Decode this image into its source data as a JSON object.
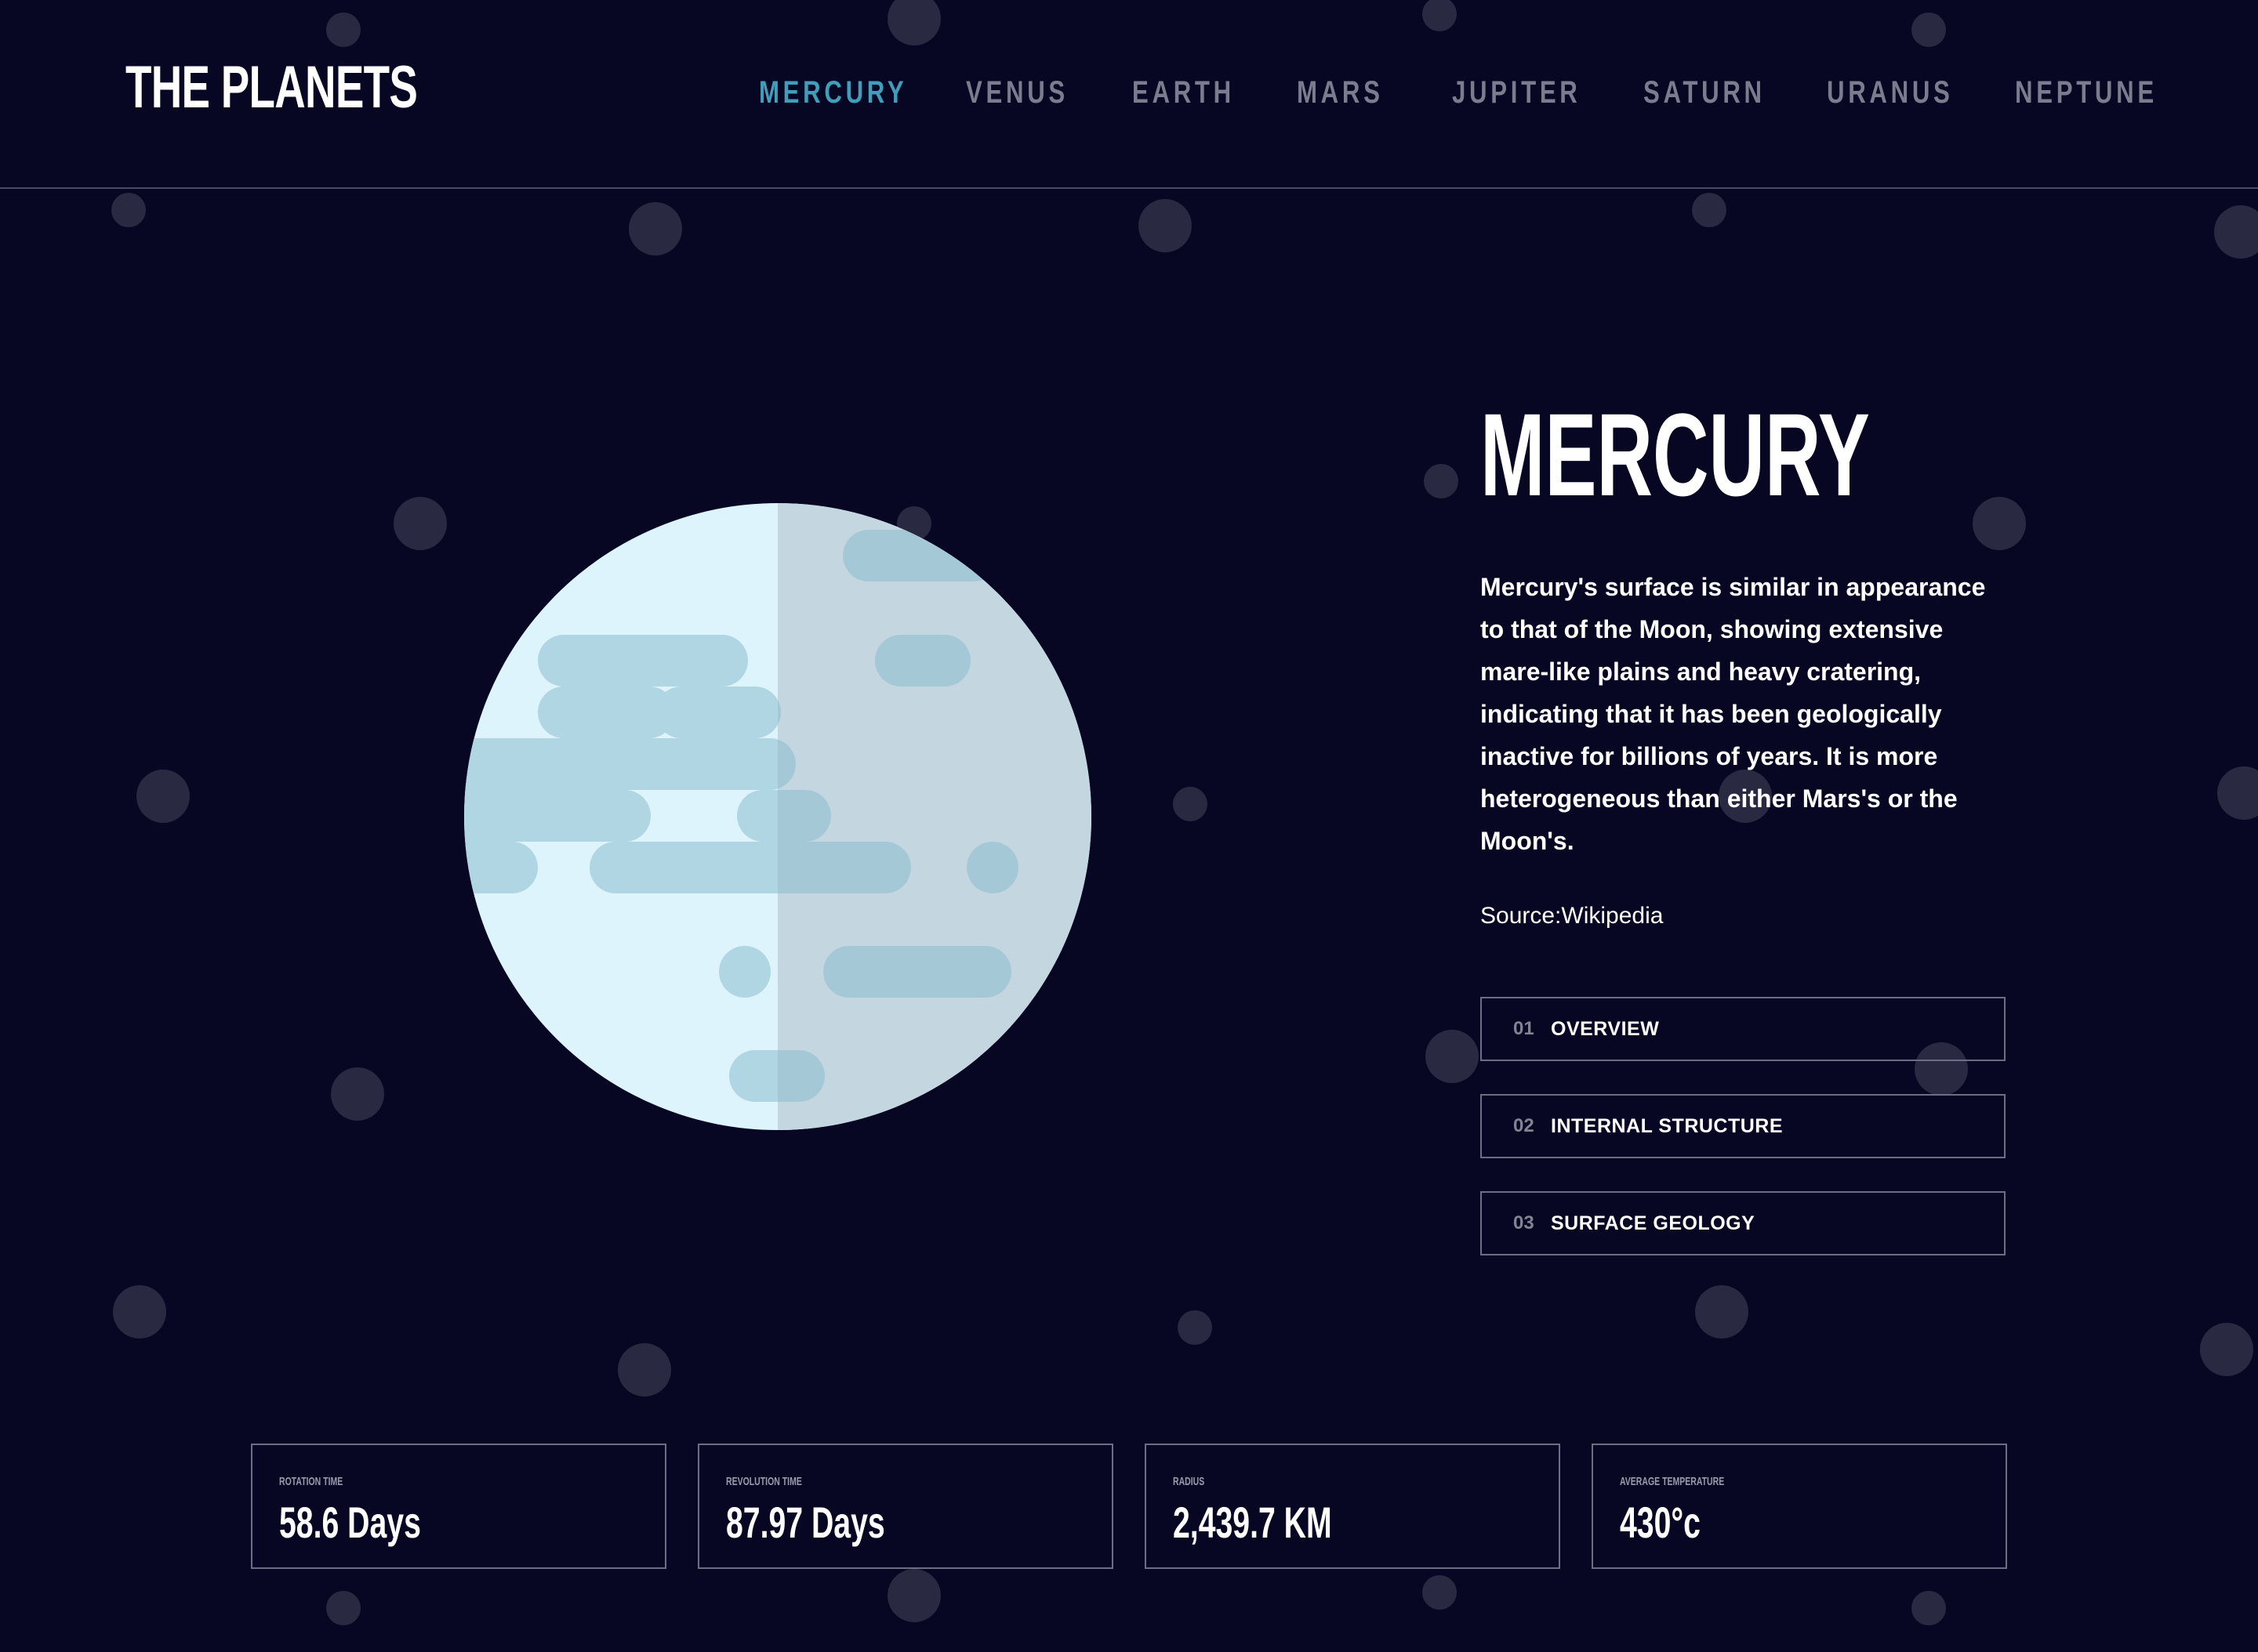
{
  "header": {
    "logo": "THE PLANETS",
    "nav": [
      {
        "label": "MERCURY",
        "active": true
      },
      {
        "label": "VENUS",
        "active": false
      },
      {
        "label": "EARTH",
        "active": false
      },
      {
        "label": "MARS",
        "active": false
      },
      {
        "label": "JUPITER",
        "active": false
      },
      {
        "label": "SATURN",
        "active": false
      },
      {
        "label": "URANUS",
        "active": false
      },
      {
        "label": "NEPTUNE",
        "active": false
      }
    ]
  },
  "planet": {
    "name": "MERCURY",
    "description": "Mercury's surface is similar in appearance to that of the Moon, showing extensive mare-like plains and heavy cratering, indicating that it has been geologically inactive for billions of years. It is more heterogeneous than either Mars's or the Moon's.",
    "source_prefix": "Source:",
    "source_link": "Wikipedia"
  },
  "tabs": [
    {
      "num": "01",
      "label": "OVERVIEW"
    },
    {
      "num": "02",
      "label": "INTERNAL STRUCTURE"
    },
    {
      "num": "03",
      "label": "SURFACE GEOLOGY"
    }
  ],
  "stats": [
    {
      "label": "ROTATION TIME",
      "value": "58.6 Days"
    },
    {
      "label": "REVOLUTION TIME",
      "value": "87.97 Days"
    },
    {
      "label": "RADIUS",
      "value": "2,439.7 KM"
    },
    {
      "label": "AVERAGE TEMPERATURE",
      "value": "430°c"
    }
  ],
  "colors": {
    "background": "#070724",
    "accent": "#419ebb",
    "nav_inactive": "#7b7d8f",
    "border": "#6d6e83",
    "planet_light": "#def4fc",
    "planet_shadow": "#d1e5ec",
    "planet_spots": "#b0d5e3"
  }
}
